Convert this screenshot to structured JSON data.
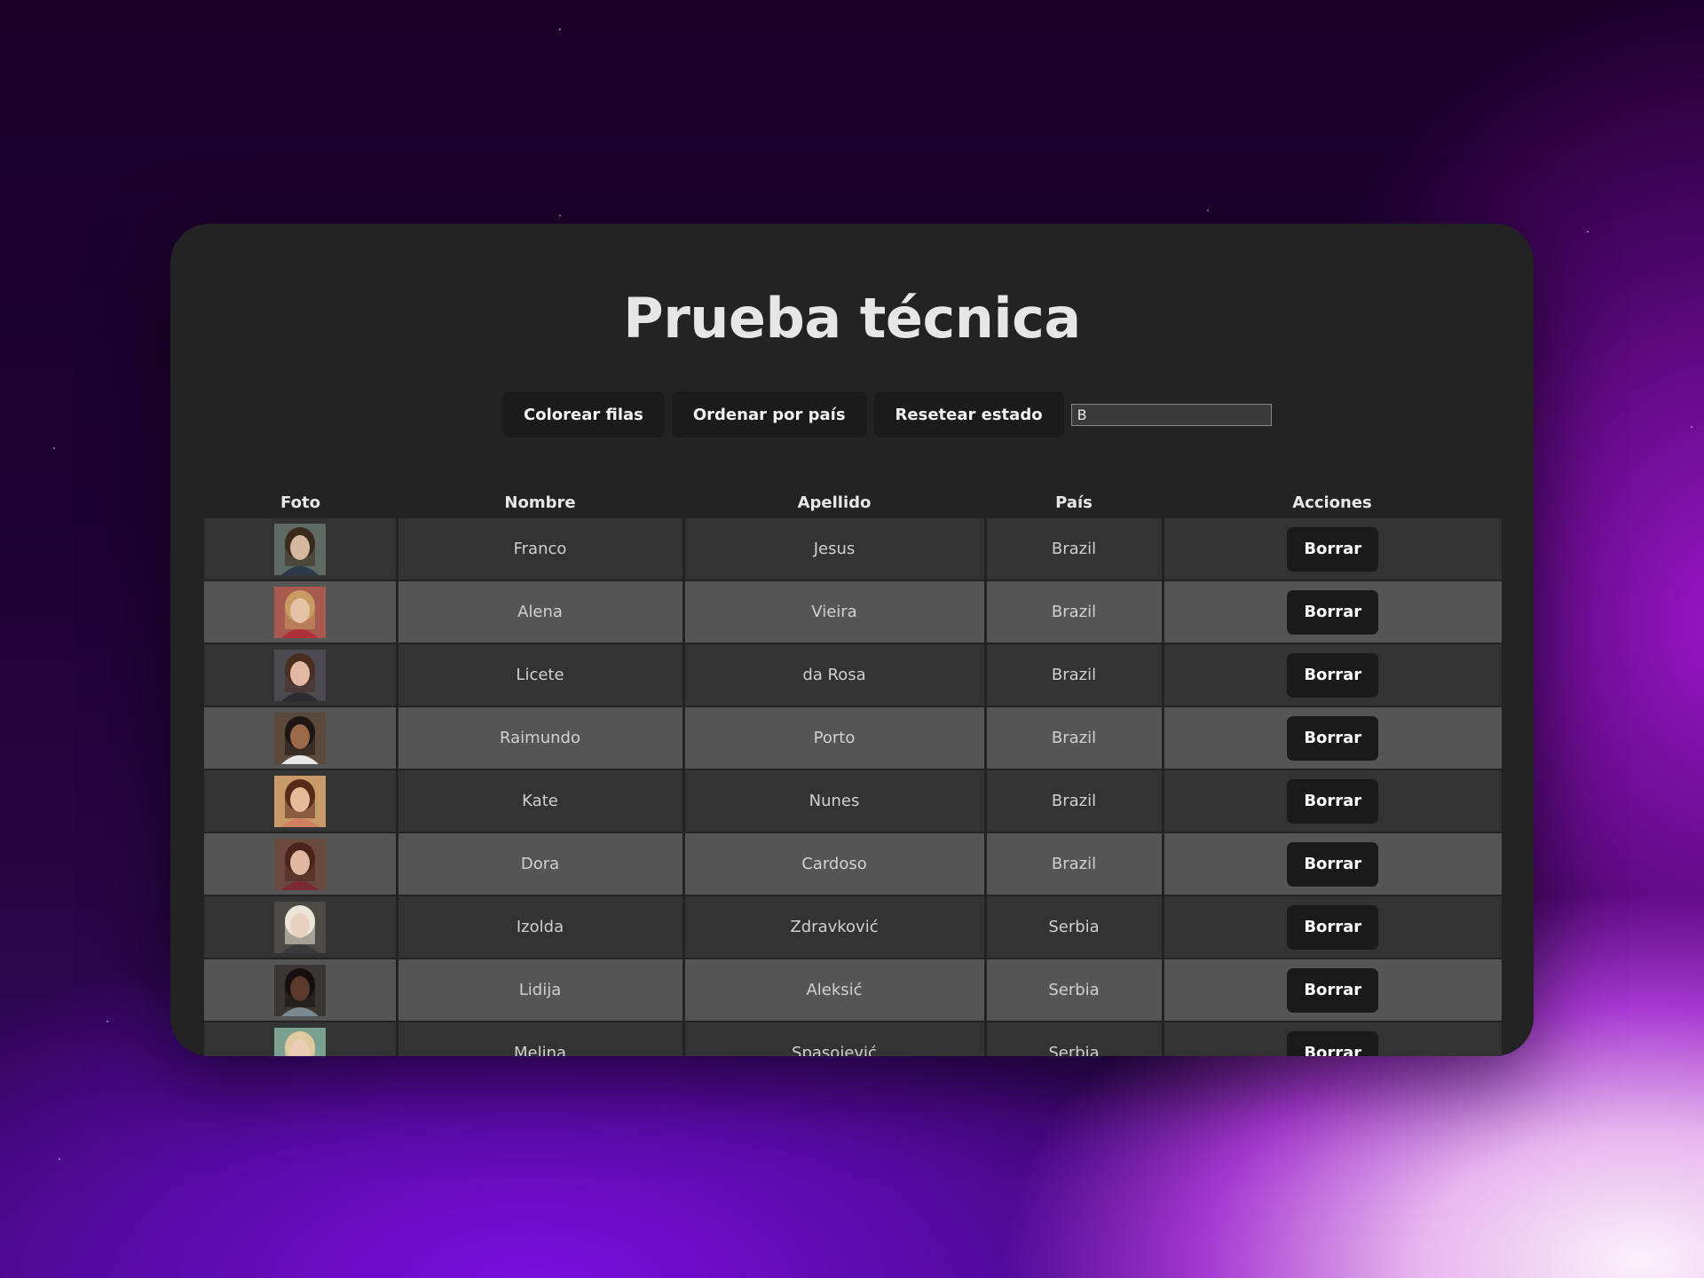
{
  "page": {
    "title": "Prueba técnica"
  },
  "toolbar": {
    "color_rows_label": "Colorear filas",
    "sort_country_label": "Ordenar por país",
    "reset_label": "Resetear estado",
    "filter_value": "B"
  },
  "table": {
    "headers": [
      "Foto",
      "Nombre",
      "Apellido",
      "País",
      "Acciones"
    ],
    "delete_label": "Borrar",
    "rows": [
      {
        "first": "Franco",
        "last": "Jesus",
        "country": "Brazil",
        "avatar": {
          "bg": "#5f6a64",
          "skin": "#d6b8a0",
          "hair": "#3a2a1e",
          "shirt": "#2b3a4a"
        }
      },
      {
        "first": "Alena",
        "last": "Vieira",
        "country": "Brazil",
        "avatar": {
          "bg": "#a85a4e",
          "skin": "#e4c2a6",
          "hair": "#c99a63",
          "shirt": "#b0303a"
        }
      },
      {
        "first": "Licete",
        "last": "da Rosa",
        "country": "Brazil",
        "avatar": {
          "bg": "#4d4a52",
          "skin": "#e1b9a2",
          "hair": "#4a2e22",
          "shirt": "#2c2c30"
        }
      },
      {
        "first": "Raimundo",
        "last": "Porto",
        "country": "Brazil",
        "avatar": {
          "bg": "#5b4a3c",
          "skin": "#9c6a48",
          "hair": "#1e1612",
          "shirt": "#e8e8e8"
        }
      },
      {
        "first": "Kate",
        "last": "Nunes",
        "country": "Brazil",
        "avatar": {
          "bg": "#c89a6a",
          "skin": "#e6bc98",
          "hair": "#5a2a18",
          "shirt": "#d08060"
        }
      },
      {
        "first": "Dora",
        "last": "Cardoso",
        "country": "Brazil",
        "avatar": {
          "bg": "#6a4a3e",
          "skin": "#e0b8a0",
          "hair": "#4a241a",
          "shirt": "#7a2a30"
        }
      },
      {
        "first": "Izolda",
        "last": "Zdravković",
        "country": "Serbia",
        "avatar": {
          "bg": "#4e4a46",
          "skin": "#ead0c0",
          "hair": "#ece6d8",
          "shirt": "#3a3a3e"
        }
      },
      {
        "first": "Lidija",
        "last": "Aleksić",
        "country": "Serbia",
        "avatar": {
          "bg": "#3a3632",
          "skin": "#5a3a2a",
          "hair": "#141010",
          "shirt": "#7a8a90"
        }
      },
      {
        "first": "Melina",
        "last": "Spasojević",
        "country": "Serbia",
        "avatar": {
          "bg": "#7aa090",
          "skin": "#ecccb4",
          "hair": "#e0c8a0",
          "shirt": "#c8a8a0"
        }
      }
    ]
  }
}
